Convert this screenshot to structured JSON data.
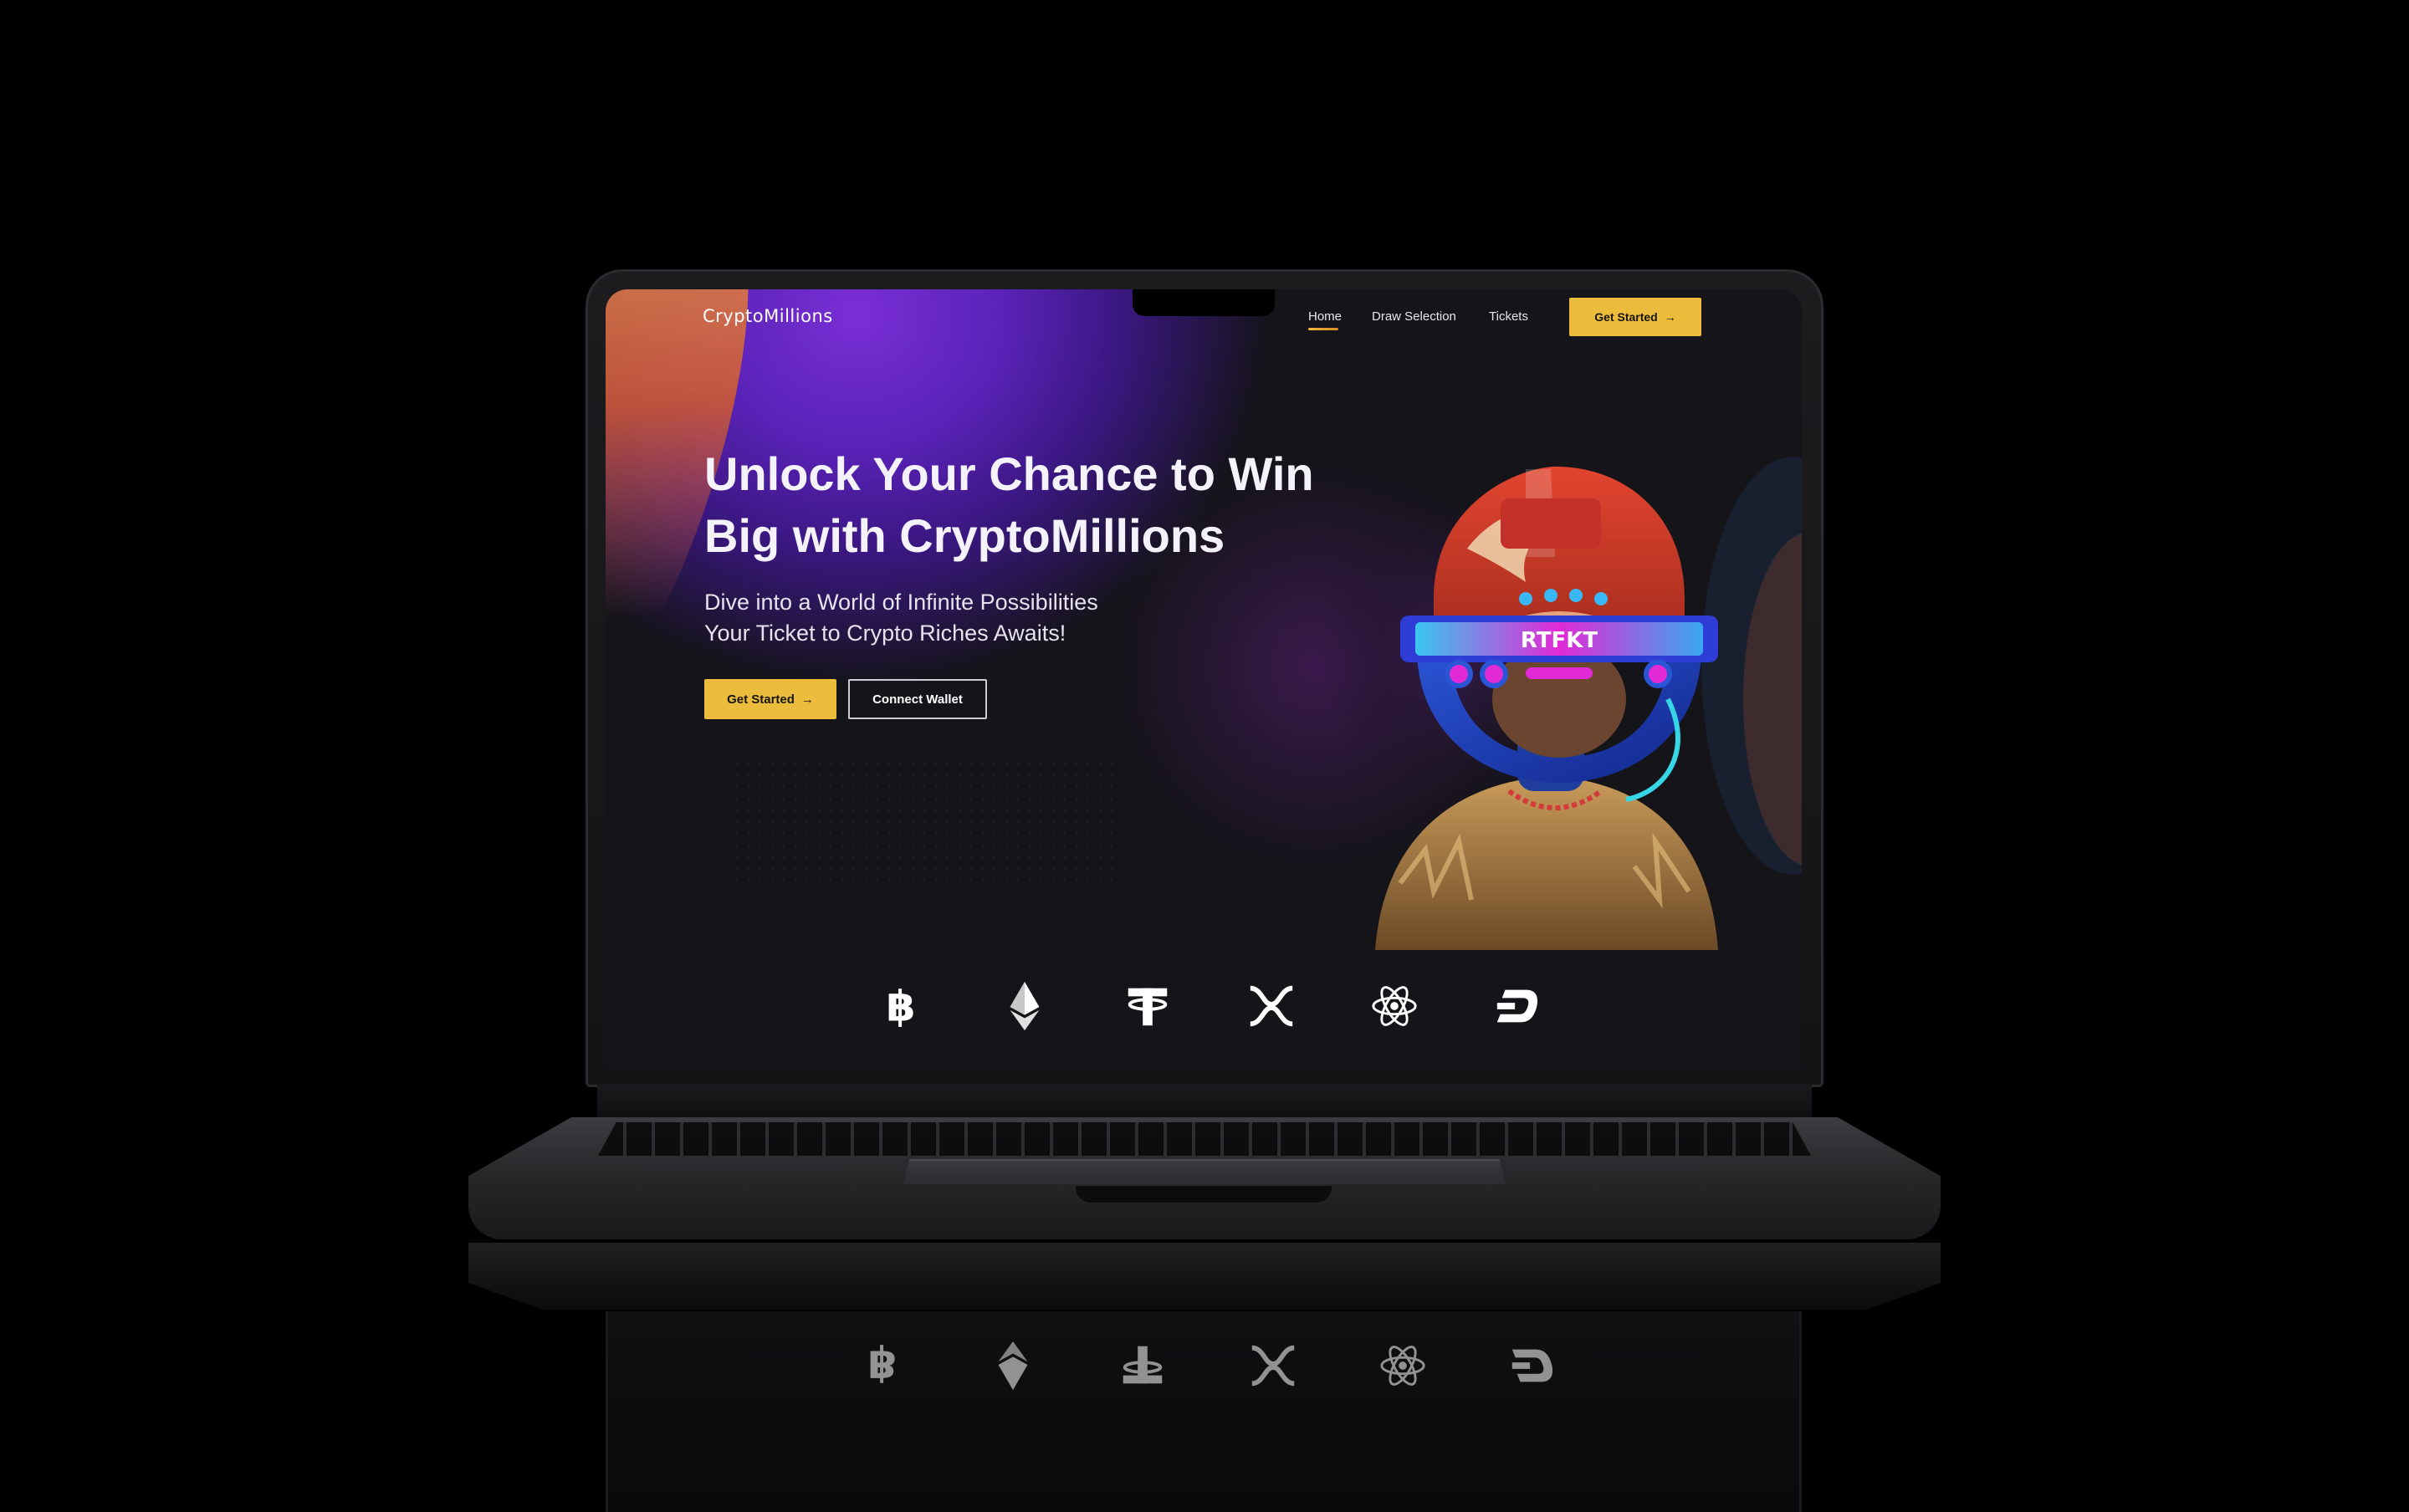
{
  "site": {
    "logo": "CryptoMillions",
    "nav": {
      "links": [
        "Home",
        "Draw Selection",
        "Tickets"
      ],
      "active": "Home",
      "cta": "Get Started",
      "cta_arrow": "→"
    },
    "hero": {
      "title_line1": "Unlock Your Chance to Win",
      "title_line2": "Big with CryptoMillions",
      "subtitle_line1": "Dive into a World of Infinite Possibilities",
      "subtitle_line2": "Your Ticket to Crypto Riches Awaits!",
      "primary_button": "Get Started",
      "primary_arrow": "→",
      "secondary_button": "Connect Wallet",
      "visor_text": "RTFKT"
    },
    "coins": [
      "bitcoin-icon",
      "ethereum-icon",
      "tether-icon",
      "xrp-icon",
      "cosmos-icon",
      "dash-icon"
    ]
  },
  "colors": {
    "accent": "#ecbd3c",
    "purple": "#5a22b8",
    "background": "#141419",
    "orange": "#f2a24a"
  }
}
